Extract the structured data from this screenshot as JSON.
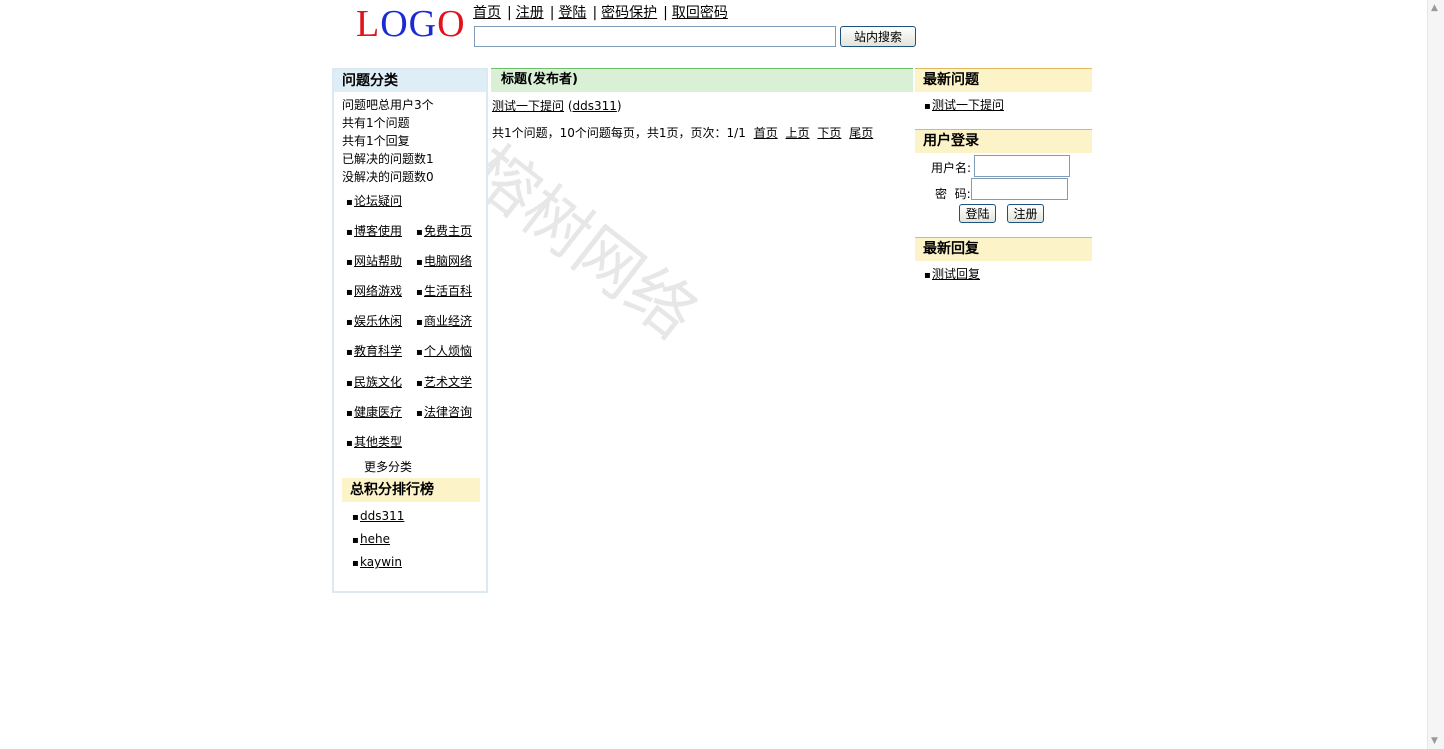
{
  "logo": {
    "chars": [
      "L",
      "O",
      "G",
      "O"
    ]
  },
  "topnav": {
    "items": [
      {
        "label": "首页"
      },
      {
        "label": "注册"
      },
      {
        "label": "登陆"
      },
      {
        "label": "密码保护"
      },
      {
        "label": "取回密码"
      }
    ],
    "separator": "|"
  },
  "search": {
    "value": "",
    "button": "站内搜索"
  },
  "left": {
    "title": "问题分类",
    "stats": [
      "问题吧总用户3个",
      "共有1个问题",
      "共有1个回复",
      "已解决的问题数1",
      "没解决的问题数0"
    ],
    "bullet": "▪",
    "categories": [
      [
        "论坛疑问"
      ],
      [
        "博客使用",
        "免费主页"
      ],
      [
        "网站帮助",
        "电脑网络"
      ],
      [
        "网络游戏",
        "生活百科"
      ],
      [
        "娱乐休闲",
        "商业经济"
      ],
      [
        "教育科学",
        "个人烦恼"
      ],
      [
        "民族文化",
        "艺术文学"
      ],
      [
        "健康医疗",
        "法律咨询"
      ],
      [
        "其他类型"
      ]
    ],
    "more": "更多分类",
    "rank_title": "总积分排行榜",
    "rank": [
      "dds311",
      "hehe",
      "kaywin"
    ]
  },
  "middle": {
    "header": "标题(发布者)",
    "question": {
      "title": "测试一下提问",
      "author": "dds311"
    },
    "pagination_text": "共1个问题，10个问题每页，共1页，页次：1/1",
    "pagination_links": [
      "首页",
      "上页",
      "下页",
      "尾页"
    ]
  },
  "right": {
    "latest_title": "最新问题",
    "latest_items": [
      "测试一下提问"
    ],
    "login_title": "用户登录",
    "username_label": "用户名:",
    "password_label": "密  码:",
    "login_button": "登陆",
    "register_button": "注册",
    "reply_title": "最新回复",
    "reply_items": [
      "测试回复"
    ]
  },
  "watermark": "大榕树网络"
}
